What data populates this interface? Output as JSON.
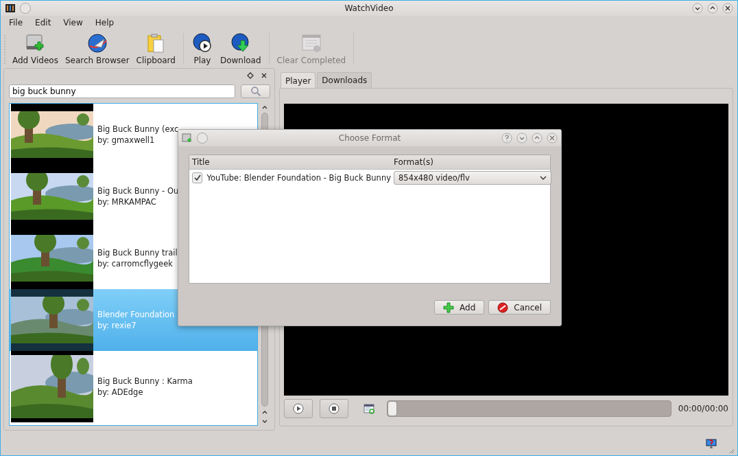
{
  "window": {
    "title": "WatchVideo"
  },
  "menu": [
    "File",
    "Edit",
    "View",
    "Help"
  ],
  "toolbar": [
    [
      {
        "label": "Add Videos",
        "kind": "add",
        "disabled": false
      },
      {
        "label": "Search Browser",
        "kind": "browser",
        "disabled": false
      },
      {
        "label": "Clipboard",
        "kind": "clipboard",
        "disabled": false
      }
    ],
    [
      {
        "label": "Play",
        "kind": "play",
        "disabled": false
      },
      {
        "label": "Download",
        "kind": "download",
        "disabled": false
      }
    ],
    [
      {
        "label": "Clear Completed",
        "kind": "clear",
        "disabled": true
      }
    ]
  ],
  "search": {
    "value": "big buck bunny"
  },
  "results": [
    {
      "title": "Big Buck Bunny (exc",
      "author": "by: gmaxwell1",
      "selected": false
    },
    {
      "title": "Big Buck Bunny - Ou",
      "author": "by: MRKAMPAC",
      "selected": false
    },
    {
      "title": "Big Buck Bunny trail",
      "author": "by: carromcflygeek",
      "selected": false
    },
    {
      "title": "Blender Foundation",
      "author": "by: rexie7",
      "selected": true
    },
    {
      "title": "Big Buck Bunny : Karma",
      "author": "by: ADEdge",
      "selected": false
    }
  ],
  "tabs": [
    {
      "label": "Player",
      "selected": true
    },
    {
      "label": "Downloads",
      "selected": false
    }
  ],
  "player": {
    "seek": {
      "level": 0
    },
    "time": "00:00/00:00"
  },
  "dialog": {
    "title": "Choose Format",
    "columns": [
      "Title",
      "Format(s)"
    ],
    "rows": [
      {
        "checked": true,
        "title": "YouTube: Blender Foundation - Big Buck Bunny",
        "format": "854x480 video/flv"
      }
    ],
    "buttons": [
      {
        "label": "Add",
        "kind": "add"
      },
      {
        "label": "Cancel",
        "kind": "cancel"
      }
    ]
  }
}
